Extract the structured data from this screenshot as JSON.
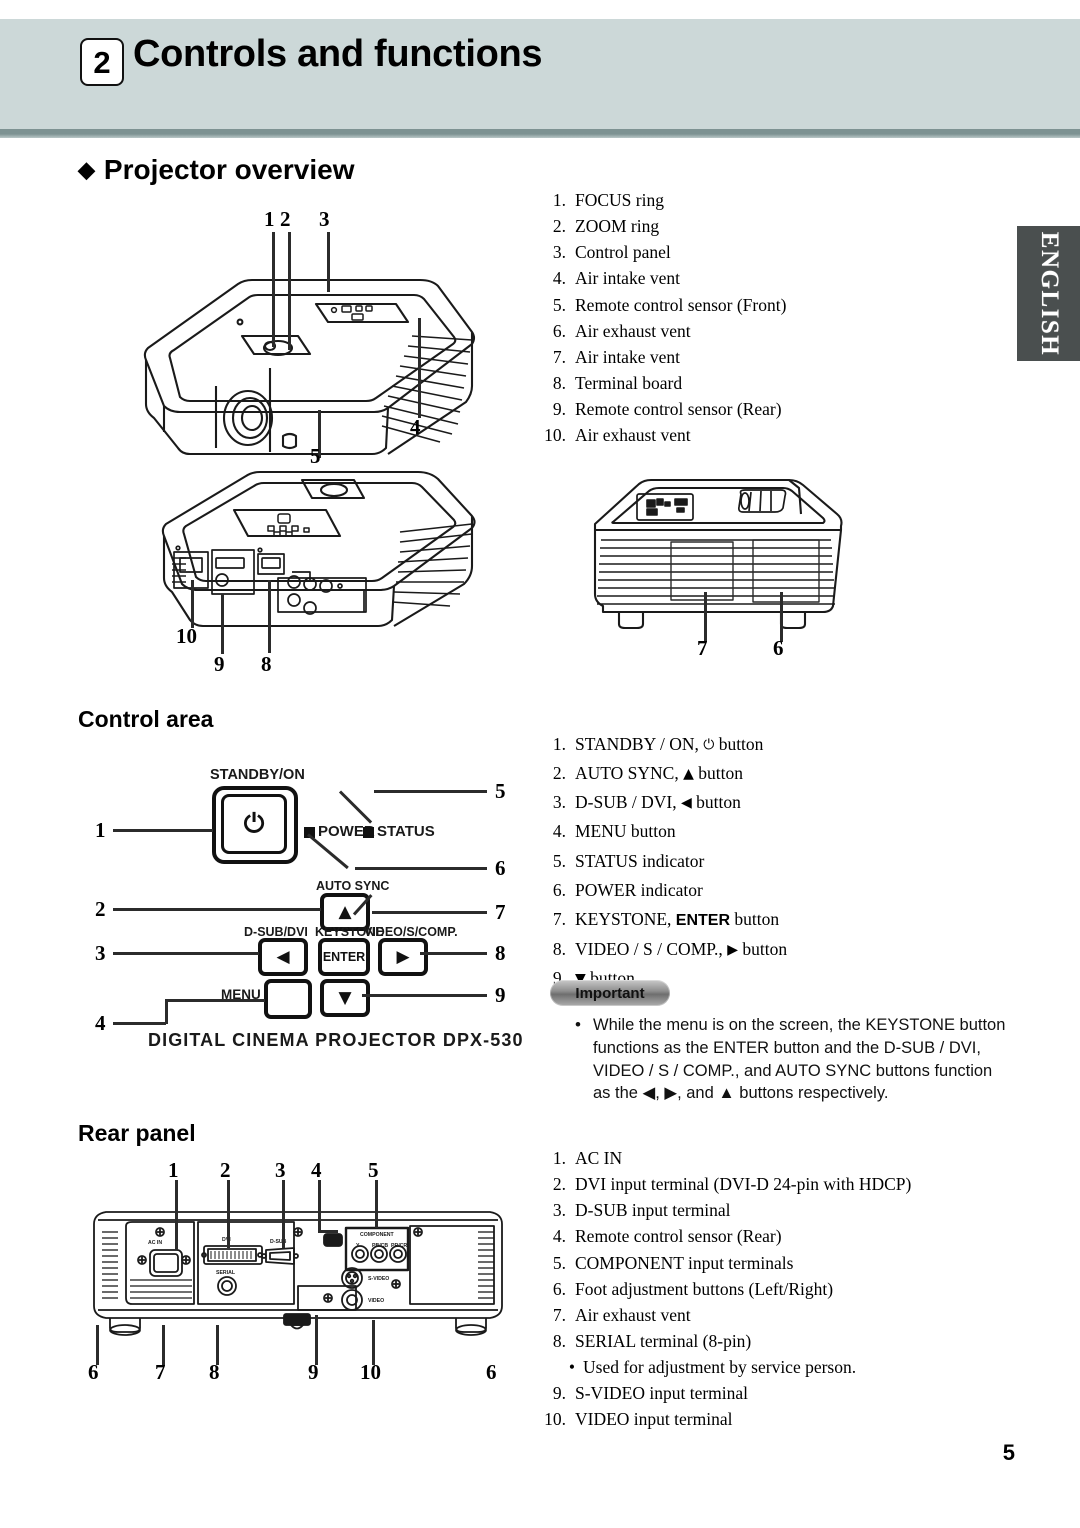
{
  "header": {
    "chapter_number": "2",
    "title": "Controls and functions"
  },
  "language_tab": "ENGLISH",
  "sections": {
    "overview_heading": "Projector overview",
    "overview_diamond": "◆",
    "control_heading": "Control area",
    "rear_heading": "Rear panel"
  },
  "overview_list": [
    {
      "n": "1.",
      "t": "FOCUS ring"
    },
    {
      "n": "2.",
      "t": "ZOOM ring"
    },
    {
      "n": "3.",
      "t": "Control panel"
    },
    {
      "n": "4.",
      "t": "Air intake vent"
    },
    {
      "n": "5.",
      "t": "Remote control sensor (Front)"
    },
    {
      "n": "6.",
      "t": "Air exhaust vent"
    },
    {
      "n": "7.",
      "t": "Air intake vent"
    },
    {
      "n": "8.",
      "t": "Terminal board"
    },
    {
      "n": "9.",
      "t": "Remote control sensor (Rear)"
    },
    {
      "n": "10.",
      "t": "Air exhaust vent"
    }
  ],
  "control_list": [
    {
      "n": "1.",
      "pre": "STANDBY / ON, ",
      "glyph": "⏻",
      "post": " button"
    },
    {
      "n": "2.",
      "pre": "AUTO SYNC, ",
      "glyph": "▲",
      "post": " button"
    },
    {
      "n": "3.",
      "pre": "D-SUB / DVI, ",
      "glyph": "◀",
      "post": " button"
    },
    {
      "n": "4.",
      "pre": "MENU button",
      "glyph": "",
      "post": ""
    },
    {
      "n": "5.",
      "pre": "STATUS indicator",
      "glyph": "",
      "post": ""
    },
    {
      "n": "6.",
      "pre": "POWER indicator",
      "glyph": "",
      "post": ""
    },
    {
      "n": "7.",
      "pre": "KEYSTONE, ",
      "glyph": "",
      "post": " button",
      "bold": "ENTER"
    },
    {
      "n": "8.",
      "pre": "VIDEO / S / COMP., ",
      "glyph": "▶",
      "post": " button"
    },
    {
      "n": "9.",
      "pre": "",
      "glyph": "▼",
      "post": " button"
    }
  ],
  "important": {
    "badge": "Important",
    "bullet": "•",
    "text": "While the menu is on the screen, the KEYSTONE button functions as the ENTER button and the D-SUB / DVI, VIDEO / S / COMP., and AUTO SYNC buttons function as the ◀, ▶, and ▲ buttons respectively."
  },
  "rear_list": [
    {
      "n": "1.",
      "t": "AC IN"
    },
    {
      "n": "2.",
      "t": "DVI input terminal (DVI-D 24-pin with HDCP)"
    },
    {
      "n": "3.",
      "t": "D-SUB input terminal"
    },
    {
      "n": "4.",
      "t": "Remote control sensor (Rear)"
    },
    {
      "n": "5.",
      "t": "COMPONENT input terminals"
    },
    {
      "n": "6.",
      "t": "Foot adjustment buttons (Left/Right)"
    },
    {
      "n": "7.",
      "t": "Air exhaust vent"
    },
    {
      "n": "8.",
      "t": "SERIAL terminal (8-pin)",
      "sub": "Used for adjustment by service person.",
      "sub_bullet": "•"
    },
    {
      "n": "9.",
      "t": "S-VIDEO input terminal"
    },
    {
      "n": "10.",
      "t": "VIDEO input terminal"
    }
  ],
  "figures": {
    "overview_top_callouts": [
      "1",
      "2",
      "3",
      "4",
      "5"
    ],
    "overview_rear_callouts": [
      "10",
      "9",
      "8"
    ],
    "overview_side_callouts": [
      "7",
      "6"
    ],
    "control_callouts_left": [
      "1",
      "2",
      "3",
      "4"
    ],
    "control_callouts_right": [
      "5",
      "6",
      "7",
      "8",
      "9"
    ],
    "rear_callouts_top": [
      "1",
      "2",
      "3",
      "4",
      "5"
    ],
    "rear_callouts_bottom": [
      "6",
      "7",
      "8",
      "9",
      "10",
      "6"
    ]
  },
  "control_panel_labels": {
    "standby": "STANDBY/ON",
    "power": "POWER",
    "status": "STATUS",
    "auto_sync": "AUTO SYNC",
    "dsub_dvi": "D-SUB/DVI",
    "keystone": "KEYSTONE",
    "video": "VIDEO/S/COMP.",
    "enter": "ENTER",
    "menu": "MENU",
    "power_glyph": "⏻",
    "up": "▲",
    "left": "◀",
    "right": "▶",
    "down": "▼",
    "model": "DIGITAL CINEMA PROJECTOR DPX-530"
  },
  "rear_panel_labels": {
    "ac_in": "AC IN",
    "dvi": "DVI",
    "dsub": "D-SUB",
    "serial": "SERIAL",
    "component": "COMPONENT",
    "y": "Y",
    "pbcb": "PB/CB",
    "prcr": "PR/CR",
    "svideo": "S-VIDEO",
    "video": "VIDEO"
  },
  "page_number": "5",
  "colors": {
    "banner": "#ccd8d8",
    "banner_rule": "#7d9292",
    "lang_tab": "#4a4f4f",
    "ink": "#111111"
  }
}
